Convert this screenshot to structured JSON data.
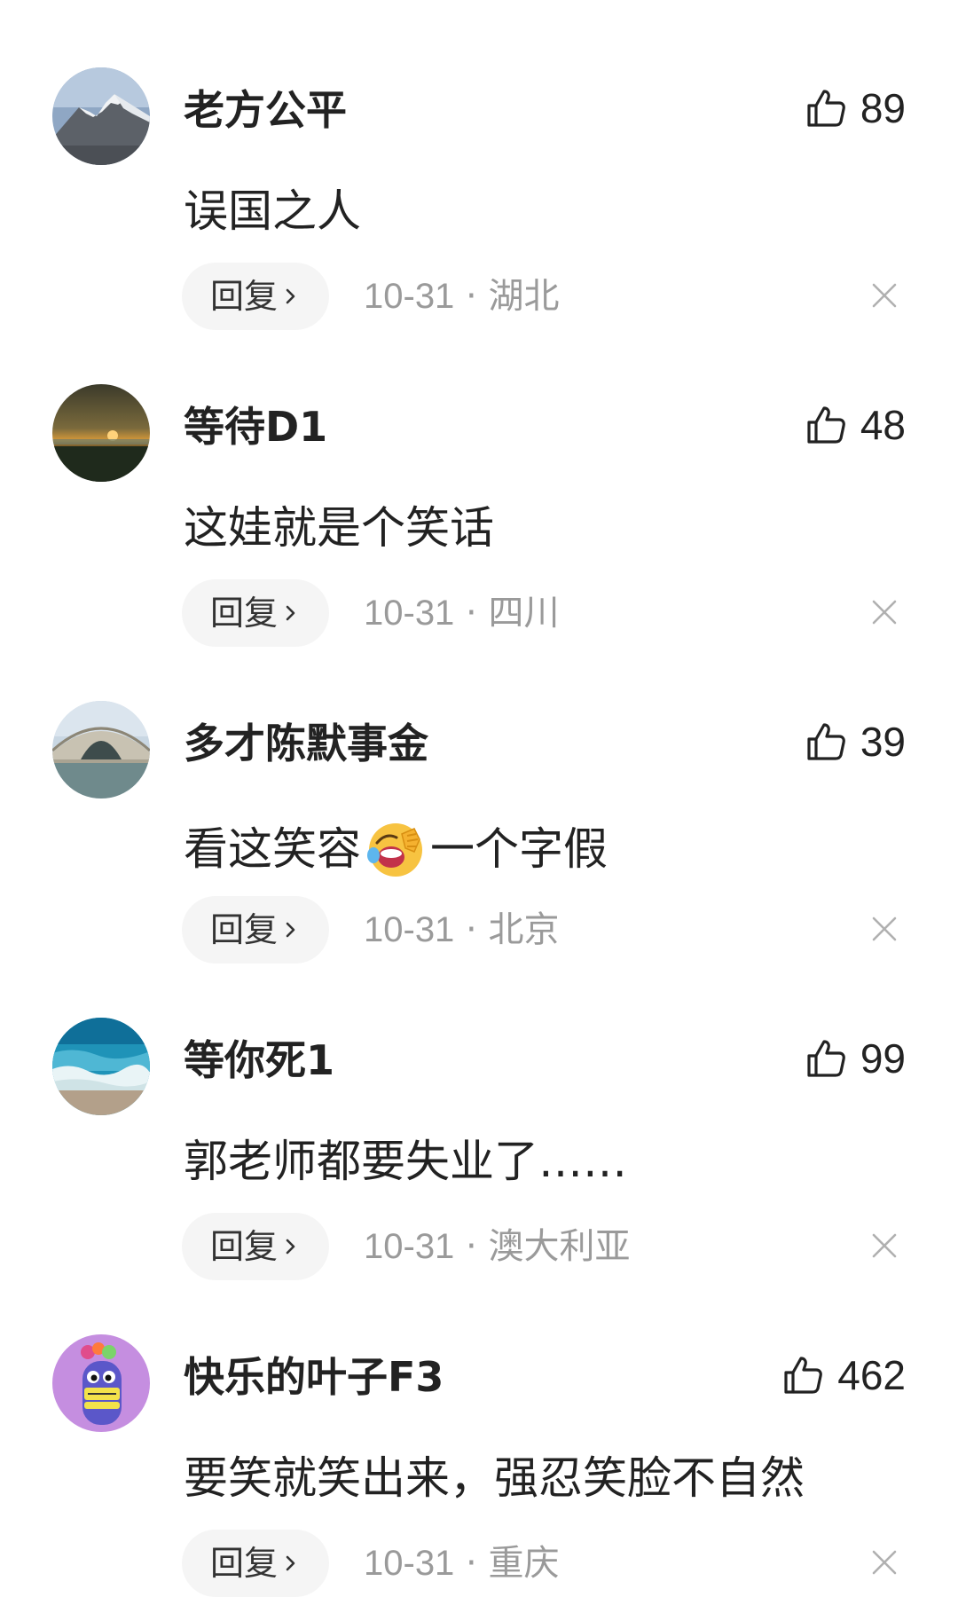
{
  "comments": [
    {
      "username": "老方公平",
      "likes": "89",
      "text": "误国之人",
      "reply_label": "回复",
      "date": "10-31",
      "separator": "·",
      "location": "湖北",
      "avatar_icon": "avatar-mountain-snow"
    },
    {
      "username": "等待D1",
      "likes": "48",
      "text": "这娃就是个笑话",
      "reply_label": "回复",
      "date": "10-31",
      "separator": "·",
      "location": "四川",
      "avatar_icon": "avatar-sunset"
    },
    {
      "username": "多才陈默事金",
      "likes": "39",
      "text_before_emoji": "看这笑容",
      "emoji": "rolling-laughing-emoji",
      "text_after_emoji": "一个字假",
      "reply_label": "回复",
      "date": "10-31",
      "separator": "·",
      "location": "北京",
      "avatar_icon": "avatar-stone-bridge"
    },
    {
      "username": "等你死1",
      "likes": "99",
      "text": "郭老师都要失业了……",
      "reply_label": "回复",
      "date": "10-31",
      "separator": "·",
      "location": "澳大利亚",
      "avatar_icon": "avatar-beach-wave"
    },
    {
      "username": "快乐的叶子F3",
      "likes": "462",
      "text": "要笑就笑出来，强忍笑脸不自然",
      "reply_label": "回复",
      "date": "10-31",
      "separator": "·",
      "location": "重庆",
      "avatar_icon": "avatar-cartoon-character"
    }
  ],
  "icons": {
    "like": "thumbs-up-icon",
    "reply_arrow": "chevron-right-icon",
    "dismiss": "close-icon"
  },
  "colors": {
    "text": "#222222",
    "meta": "#9a9a9a",
    "reply_bg": "#f5f5f5",
    "background": "#ffffff"
  }
}
